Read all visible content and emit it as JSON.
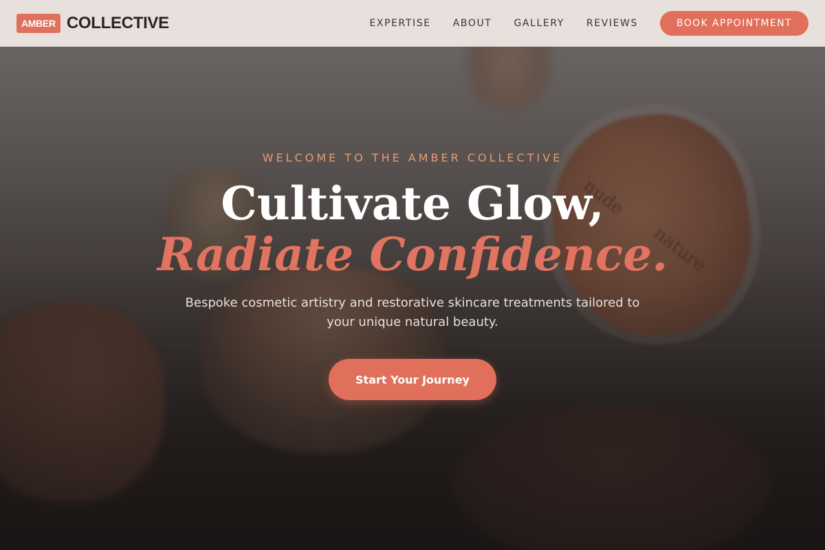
{
  "brand": {
    "badge": "AMBER",
    "name": "COLLECTIVE",
    "accent_color": "#e06f5b"
  },
  "nav": {
    "links": [
      "EXPERTISE",
      "ABOUT",
      "GALLERY",
      "REVIEWS"
    ],
    "cta_label": "BOOK APPOINTMENT"
  },
  "hero": {
    "eyebrow": "WELCOME TO THE AMBER COLLECTIVE",
    "headline_line1": "Cultivate Glow,",
    "headline_line2": "Radiate Confidence.",
    "subtitle": "Bespoke cosmetic artistry and restorative skincare treatments tailored to your unique natural beauty.",
    "cta_label": "Start Your Journey",
    "background_image": {
      "lid_text_1": "nude",
      "lid_text_2": "nature"
    }
  }
}
